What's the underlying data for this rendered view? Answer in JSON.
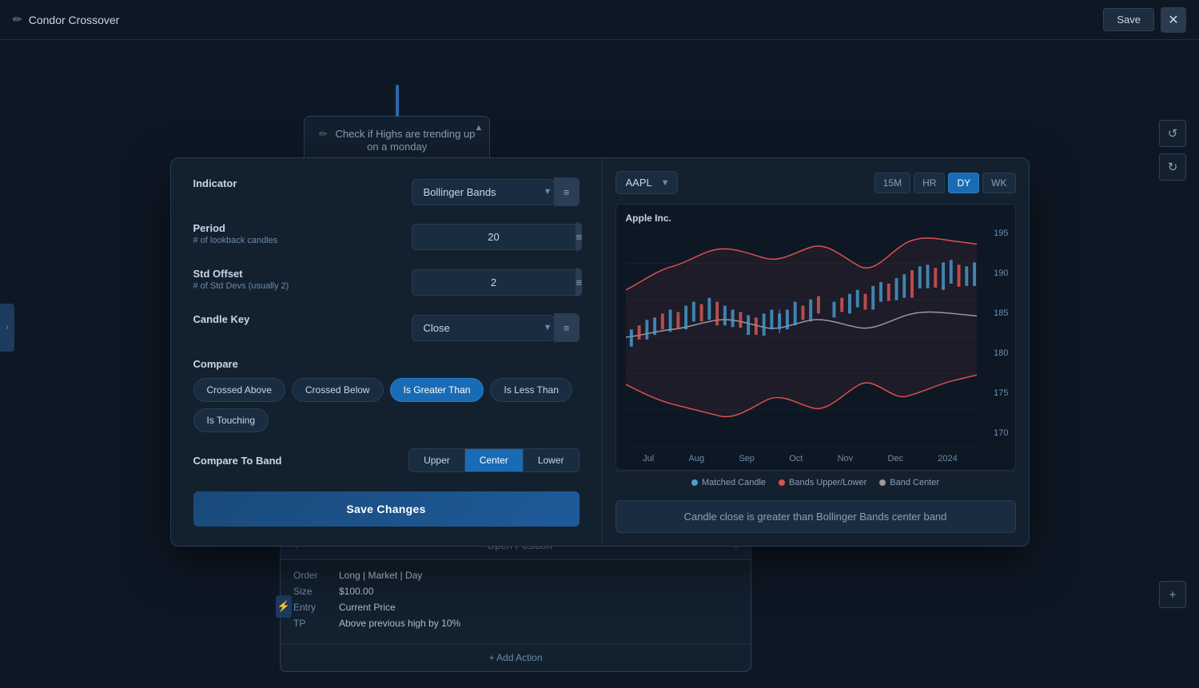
{
  "app": {
    "title": "Condor Crossover",
    "save_label": "Save",
    "close_label": "✕"
  },
  "background": {
    "node_text_line1": "Check if Highs are trending up",
    "node_text_line2": "on a monday",
    "order": {
      "header": "Open Position",
      "order_label": "Order",
      "order_value": "Long | Market | Day",
      "size_label": "Size",
      "size_value": "$100.00",
      "entry_label": "Entry",
      "entry_value": "Current Price",
      "tp_label": "TP",
      "tp_value": "Above previous high by 10%"
    },
    "add_action": "+ Add Action"
  },
  "modal": {
    "indicator_label": "Indicator",
    "indicator_value": "Bollinger Bands",
    "period_label": "Period",
    "period_sublabel": "# of lookback candles",
    "period_value": "20",
    "std_label": "Std Offset",
    "std_sublabel": "# of Std Devs (usually 2)",
    "std_value": "2",
    "candle_key_label": "Candle Key",
    "candle_key_value": "Close",
    "compare_label": "Compare",
    "compare_options": [
      {
        "id": "crossed_above",
        "label": "Crossed Above",
        "active": false
      },
      {
        "id": "crossed_below",
        "label": "Crossed Below",
        "active": false
      },
      {
        "id": "is_greater_than",
        "label": "Is Greater Than",
        "active": true
      },
      {
        "id": "is_less_than",
        "label": "Is Less Than",
        "active": false
      },
      {
        "id": "is_touching",
        "label": "Is Touching",
        "active": false
      }
    ],
    "compare_to_band_label": "Compare To Band",
    "band_options": [
      {
        "id": "upper",
        "label": "Upper",
        "active": false
      },
      {
        "id": "center",
        "label": "Center",
        "active": true
      },
      {
        "id": "lower",
        "label": "Lower",
        "active": false
      }
    ],
    "save_changes_label": "Save Changes"
  },
  "chart": {
    "symbol": "AAPL",
    "title": "Apple Inc.",
    "timeframes": [
      {
        "id": "15m",
        "label": "15M",
        "active": false
      },
      {
        "id": "hr",
        "label": "HR",
        "active": false
      },
      {
        "id": "dy",
        "label": "DY",
        "active": true
      },
      {
        "id": "wk",
        "label": "WK",
        "active": false
      }
    ],
    "y_labels": [
      "195",
      "190",
      "185",
      "180",
      "175",
      "170"
    ],
    "x_labels": [
      "Jul",
      "Aug",
      "Sep",
      "Oct",
      "Nov",
      "Dec",
      "2024"
    ],
    "legend": [
      {
        "color": "#4a9fd4",
        "label": "Matched Candle"
      },
      {
        "color": "#e05050",
        "label": "Bands Upper/Lower"
      },
      {
        "color": "#9a9a9a",
        "label": "Band Center"
      }
    ],
    "description": "Candle close is greater than Bollinger Bands center band"
  }
}
